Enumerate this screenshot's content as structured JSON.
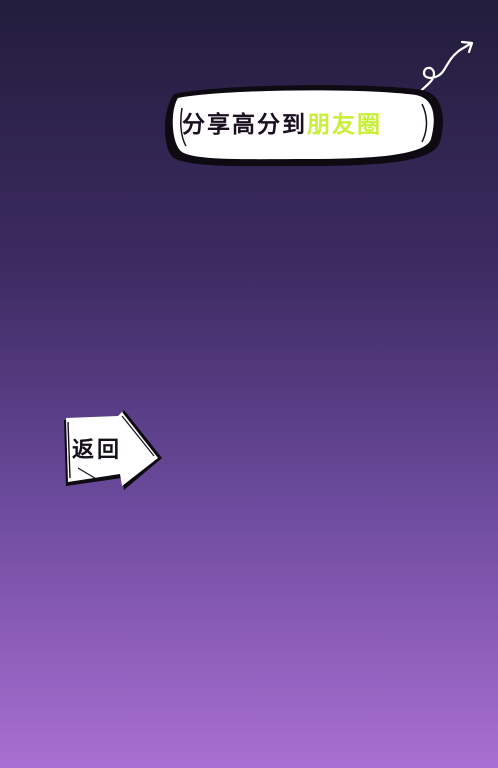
{
  "background": {
    "gradient_top": "#221d3c",
    "gradient_bottom": "#a96fd2"
  },
  "share": {
    "text_prefix": "分享高分到",
    "text_highlight": "朋友圈",
    "highlight_color": "#c8f03a"
  },
  "back_button": {
    "label": "返回"
  }
}
